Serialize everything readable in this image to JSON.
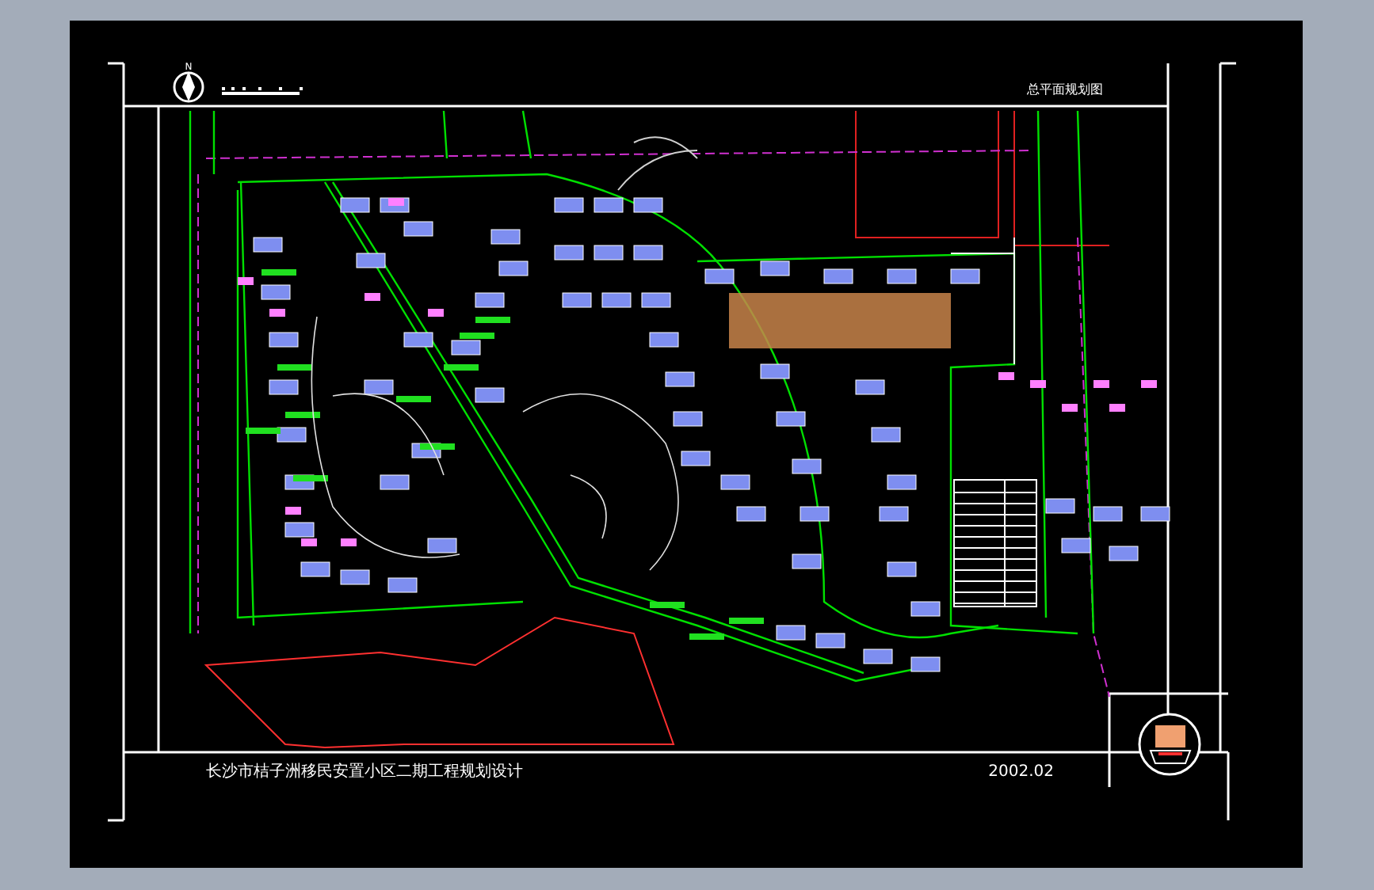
{
  "north_arrow": {
    "label": "N"
  },
  "sheet_title": "总平面规划图",
  "title_block": {
    "project_title": "长沙市桔子洲移民安置小区二期工程规划设计",
    "date": "2002.02"
  }
}
